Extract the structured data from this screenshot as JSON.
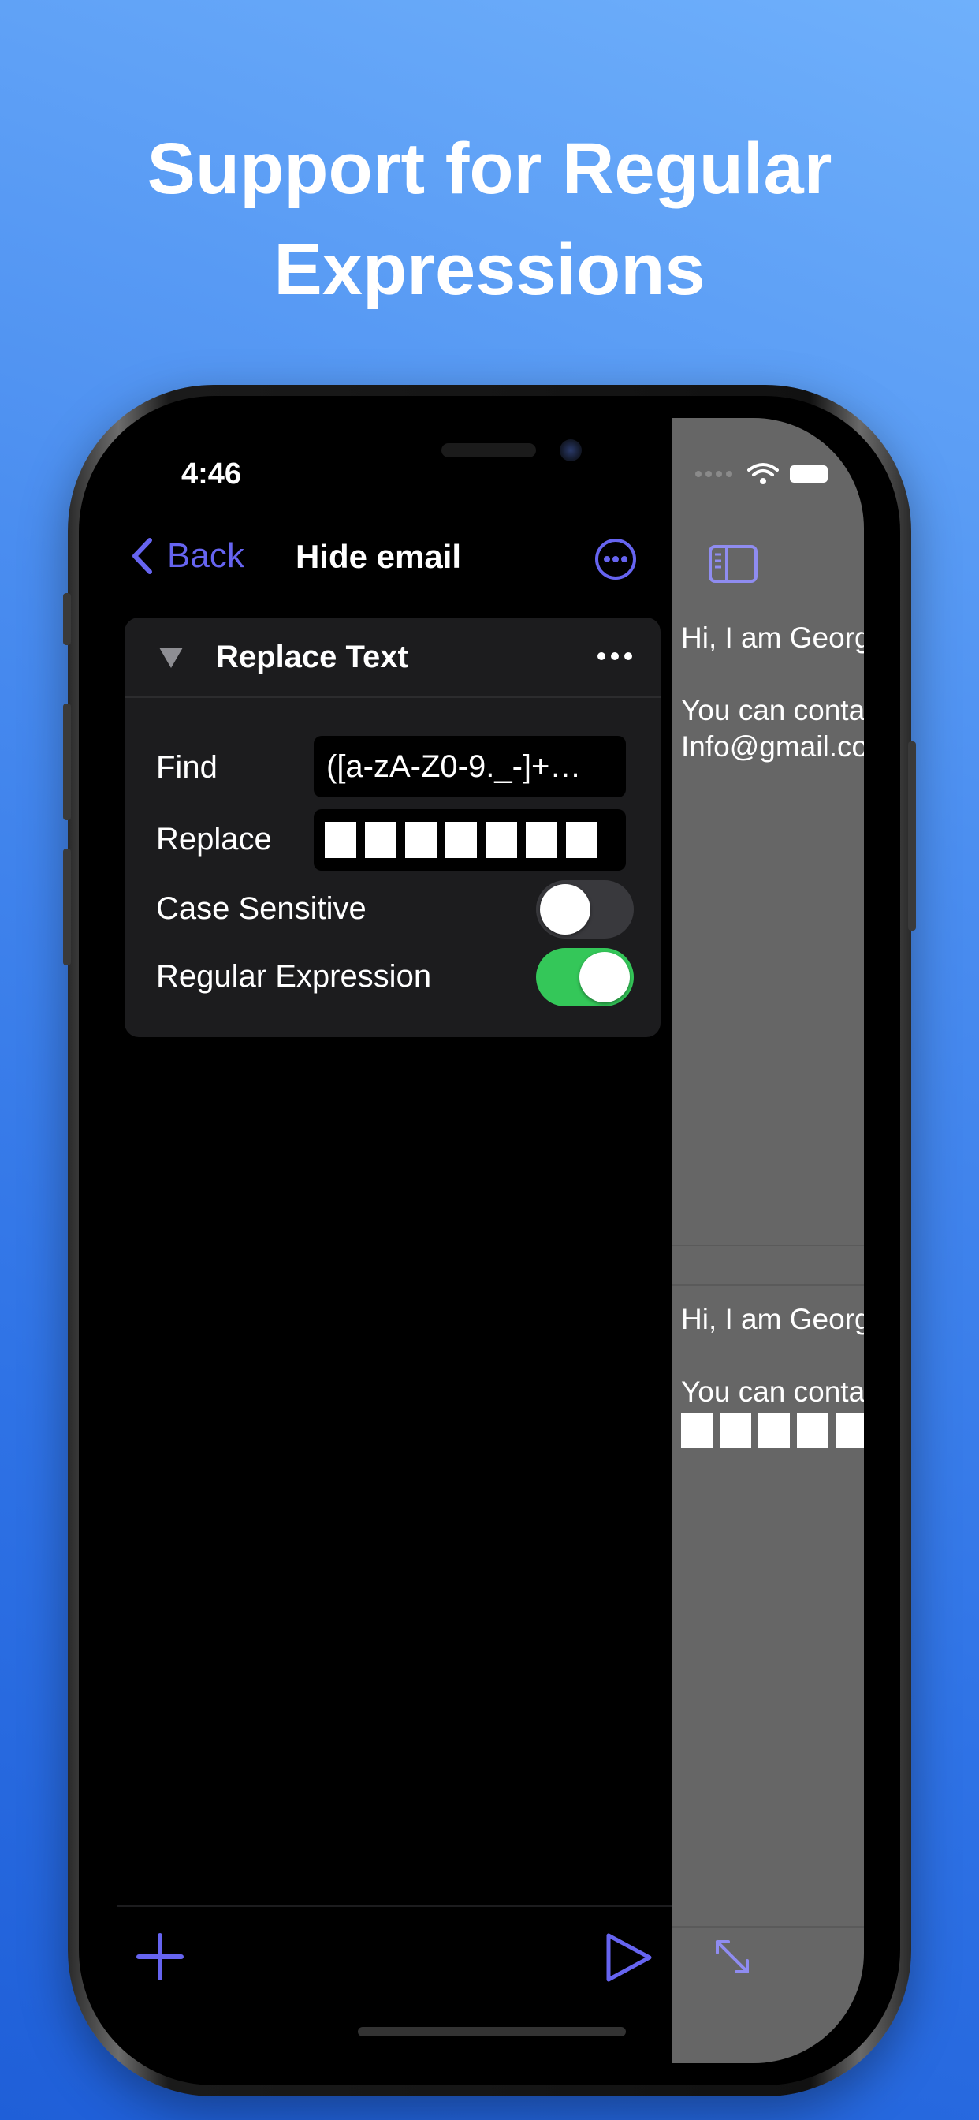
{
  "headline": {
    "line1": "Support for Regular",
    "line2": "Expressions"
  },
  "status_bar": {
    "time": "4:46"
  },
  "nav": {
    "back_label": "Back",
    "title": "Hide email"
  },
  "card": {
    "title": "Replace Text",
    "find_label": "Find",
    "find_value": "([a-zA-Z0-9._-]+…",
    "replace_label": "Replace",
    "replace_blocks": 7,
    "case_sensitive_label": "Case Sensitive",
    "case_sensitive_on": false,
    "regex_label": "Regular Expression",
    "regex_on": true
  },
  "preview": {
    "original_line1": "Hi, I am Georg",
    "original_line2": "You can conta",
    "original_line3": "Info@gmail.co",
    "result_line1": "Hi, I am Georg",
    "result_line2": "You can conta",
    "result_blocks": 5
  },
  "icons": {
    "back": "chevron-left-icon",
    "more": "ellipsis-circle-icon",
    "card_more": "ellipsis-icon",
    "add": "plus-icon",
    "run": "play-icon",
    "sidebar": "sidebar-icon",
    "expand": "expand-arrows-icon",
    "wifi": "wifi-icon",
    "battery": "battery-icon"
  },
  "colors": {
    "accent": "#6664f0",
    "toggle_on": "#34c759",
    "toggle_off": "#39393d",
    "card_bg": "#1c1c1e",
    "preview_bg": "#666666"
  }
}
